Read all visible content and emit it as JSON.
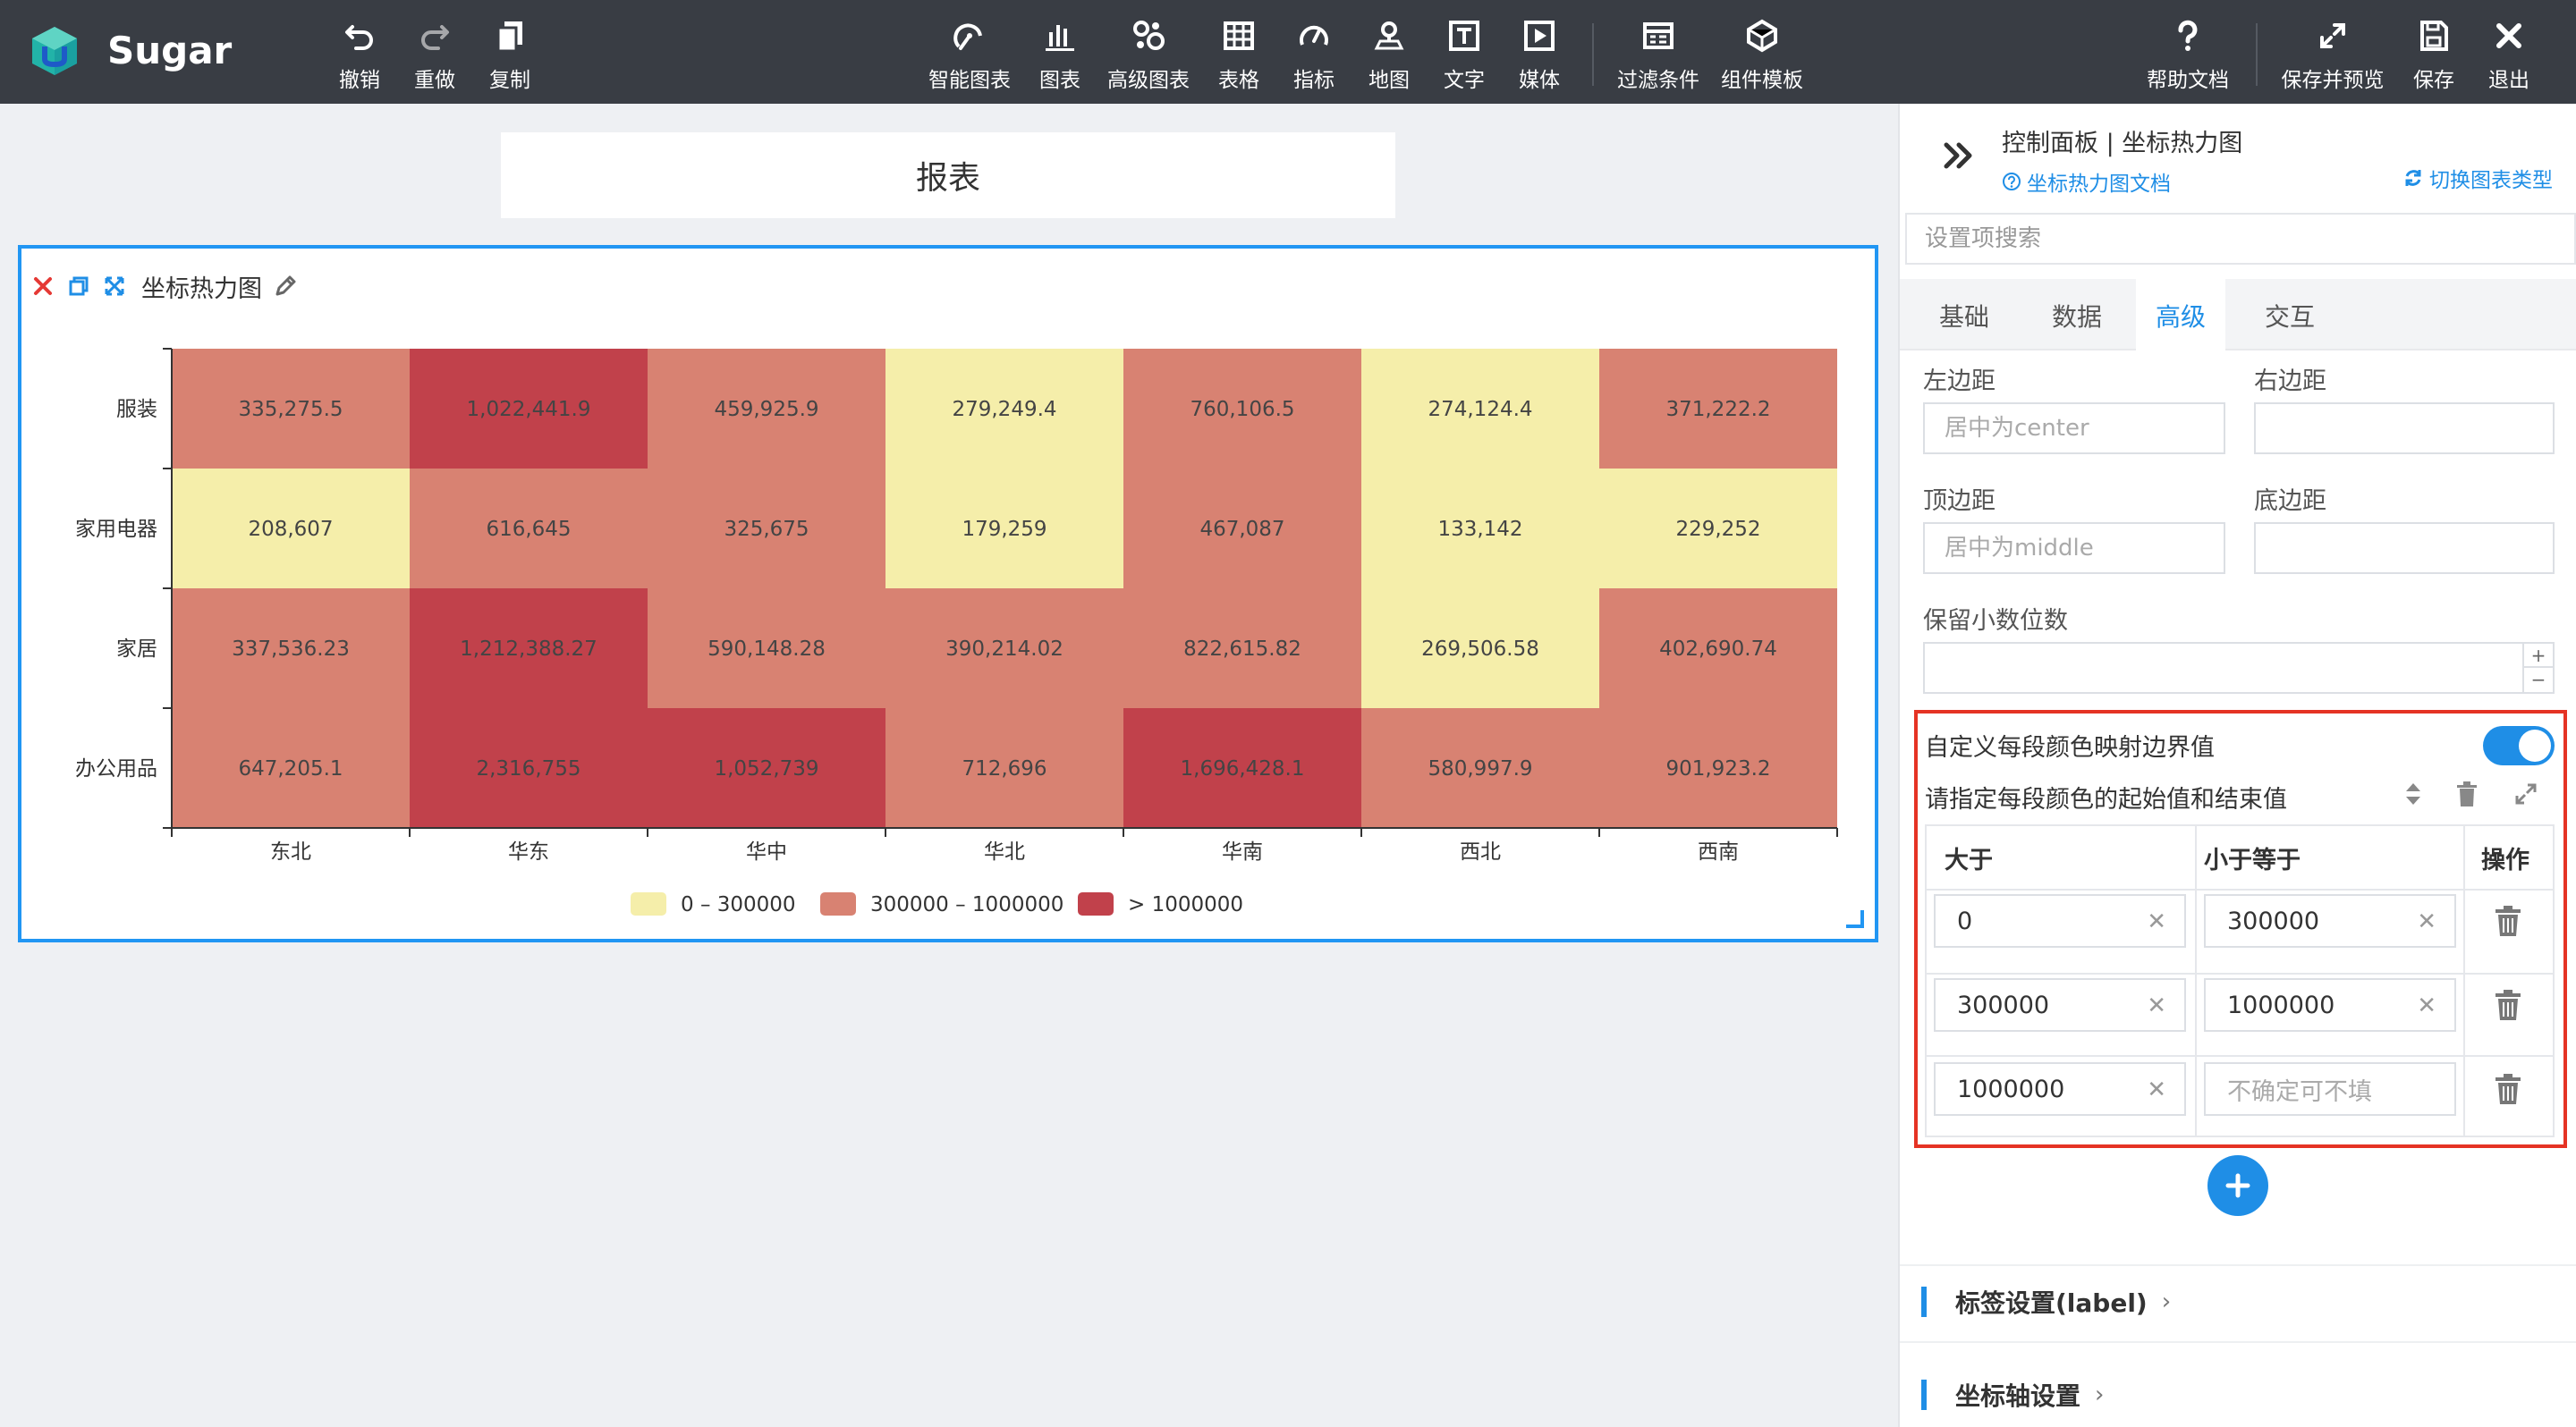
{
  "app": {
    "brand": "Sugar"
  },
  "toolbar": {
    "left": [
      {
        "id": "undo",
        "label": "撤销",
        "icon": "undo-icon"
      },
      {
        "id": "redo",
        "label": "重做",
        "icon": "redo-icon"
      },
      {
        "id": "copy",
        "label": "复制",
        "icon": "copy-icon"
      }
    ],
    "center": [
      {
        "id": "smart-chart",
        "label": "智能图表",
        "icon": "smart-chart-icon"
      },
      {
        "id": "chart",
        "label": "图表",
        "icon": "bar-chart-icon"
      },
      {
        "id": "advanced-chart",
        "label": "高级图表",
        "icon": "advanced-chart-icon"
      },
      {
        "id": "table",
        "label": "表格",
        "icon": "table-icon"
      },
      {
        "id": "indicator",
        "label": "指标",
        "icon": "gauge-icon"
      },
      {
        "id": "map",
        "label": "地图",
        "icon": "map-pin-icon"
      },
      {
        "id": "text",
        "label": "文字",
        "icon": "text-icon"
      },
      {
        "id": "media",
        "label": "媒体",
        "icon": "media-icon"
      },
      {
        "id": "filter",
        "label": "过滤条件",
        "icon": "filter-icon"
      },
      {
        "id": "template",
        "label": "组件模板",
        "icon": "template-icon"
      }
    ],
    "right": [
      {
        "id": "help",
        "label": "帮助文档",
        "icon": "help-icon"
      },
      {
        "id": "save-preview",
        "label": "保存并预览",
        "icon": "expand-icon"
      },
      {
        "id": "save",
        "label": "保存",
        "icon": "save-icon"
      },
      {
        "id": "exit",
        "label": "退出",
        "icon": "close-icon"
      }
    ]
  },
  "canvas": {
    "report_title": "报表",
    "chart_title": "坐标热力图"
  },
  "chart_data": {
    "type": "heatmap",
    "x": [
      "东北",
      "华东",
      "华中",
      "华北",
      "华南",
      "西北",
      "西南"
    ],
    "y": [
      "服装",
      "家用电器",
      "家居",
      "办公用品"
    ],
    "values": [
      [
        "335,275.5",
        "1,022,441.9",
        "459,925.9",
        "279,249.4",
        "760,106.5",
        "274,124.4",
        "371,222.2"
      ],
      [
        "208,607",
        "616,645",
        "325,675",
        "179,259",
        "467,087",
        "133,142",
        "229,252"
      ],
      [
        "337,536.23",
        "1,212,388.27",
        "590,148.28",
        "390,214.02",
        "822,615.82",
        "269,506.58",
        "402,690.74"
      ],
      [
        "647,205.1",
        "2,316,755",
        "1,052,739",
        "712,696",
        "1,696,428.1",
        "580,997.9",
        "901,923.2"
      ]
    ],
    "pieces": [
      {
        "label": "0 – 300000",
        "min": 0,
        "max": 300000,
        "color": "#f5eeaa"
      },
      {
        "label": "300000 – 1000000",
        "min": 300000,
        "max": 1000000,
        "color": "#d88272"
      },
      {
        "label": "> 1000000",
        "min": 1000000,
        "color": "#c1414b"
      }
    ],
    "legend": "bottom-center"
  },
  "panel": {
    "title": "控制面板 | 坐标热力图",
    "doc_link": "坐标热力图文档",
    "switch_type": "切换图表类型",
    "search_placeholder": "设置项搜索",
    "tabs": [
      "基础",
      "数据",
      "高级",
      "交互"
    ],
    "active_tab": "高级",
    "left_margin": {
      "label": "左边距",
      "placeholder": "居中为center",
      "value": ""
    },
    "right_margin": {
      "label": "右边距",
      "value": ""
    },
    "top_margin": {
      "label": "顶边距",
      "placeholder": "居中为middle",
      "value": ""
    },
    "bottom_margin": {
      "label": "底边距",
      "value": ""
    },
    "decimals": {
      "label": "保留小数位数",
      "value": ""
    },
    "custom_pieces": {
      "toggle_label": "自定义每段颜色映射边界值",
      "enabled": true,
      "hint": "请指定每段颜色的起始值和结束值",
      "col_gt": "大于",
      "col_lte": "小于等于",
      "col_op": "操作",
      "rows": [
        {
          "gt": "0",
          "lte": "300000"
        },
        {
          "gt": "300000",
          "lte": "1000000"
        },
        {
          "gt": "1000000",
          "lte": "",
          "lte_placeholder": "不确定可不填"
        }
      ]
    },
    "sections": [
      "标签设置(label)",
      "坐标轴设置"
    ]
  },
  "colors": {
    "accent": "#1f8ee6",
    "highlight": "#e53324",
    "toolbar_bg": "#393d44"
  }
}
